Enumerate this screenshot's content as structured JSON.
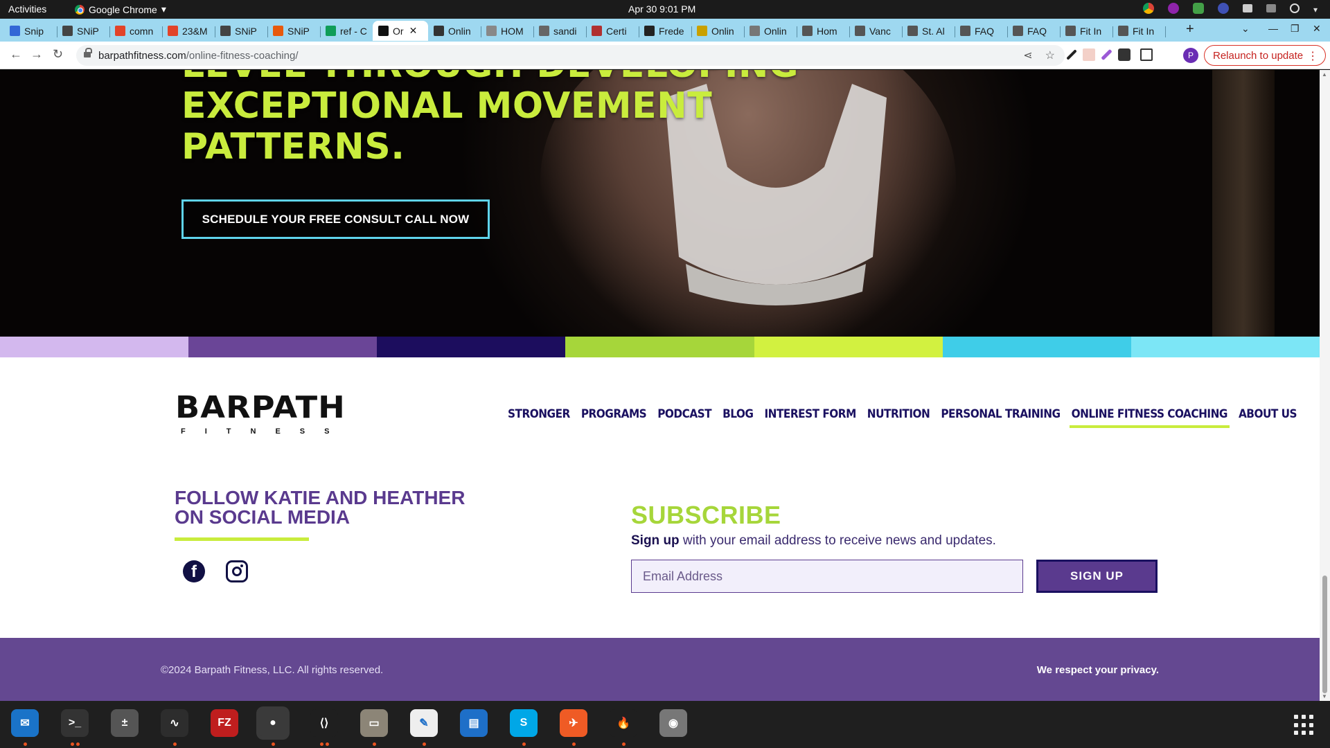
{
  "system": {
    "activities": "Activities",
    "app_name": "Google Chrome",
    "clock": "Apr 30  9:01 PM"
  },
  "browser": {
    "tabs": [
      {
        "label": "Snip",
        "icon": "doc-icon",
        "color": "#3367d6"
      },
      {
        "label": "SNiP",
        "icon": "snip-icon",
        "color": "#444444"
      },
      {
        "label": "comn",
        "icon": "gitlab-icon",
        "color": "#e24329"
      },
      {
        "label": "23&M",
        "icon": "gitlab-icon",
        "color": "#e24329"
      },
      {
        "label": "SNiP",
        "icon": "snip-icon",
        "color": "#444444"
      },
      {
        "label": "SNiP",
        "icon": "snip-orange-icon",
        "color": "#e8590c"
      },
      {
        "label": "ref - C",
        "icon": "sheets-icon",
        "color": "#0f9d58"
      },
      {
        "label": "Or",
        "icon": "barpath-icon",
        "color": "#111111",
        "active": true
      },
      {
        "label": "Onlin",
        "icon": "bird-icon",
        "color": "#333333"
      },
      {
        "label": "HOM",
        "icon": "circle-icon",
        "color": "#888888"
      },
      {
        "label": "sandi",
        "icon": "globe-icon",
        "color": "#666666"
      },
      {
        "label": "Certi",
        "icon": "ship-icon",
        "color": "#b03030"
      },
      {
        "label": "Frede",
        "icon": "note-icon",
        "color": "#222222"
      },
      {
        "label": "Onlin",
        "icon": "grid-icon",
        "color": "#c9a000"
      },
      {
        "label": "Onlin",
        "icon": "dash-icon",
        "color": "#777777"
      },
      {
        "label": "Hom",
        "icon": "fit-icon",
        "color": "#555555"
      },
      {
        "label": "Vanc",
        "icon": "fit-icon",
        "color": "#555555"
      },
      {
        "label": "St. Al",
        "icon": "fit-icon",
        "color": "#555555"
      },
      {
        "label": "FAQ",
        "icon": "fit-icon",
        "color": "#555555"
      },
      {
        "label": "FAQ",
        "icon": "fit-icon",
        "color": "#555555"
      },
      {
        "label": "Fit In",
        "icon": "fit-icon",
        "color": "#555555"
      },
      {
        "label": "Fit In",
        "icon": "fit-icon",
        "color": "#555555"
      }
    ],
    "new_tab": "+",
    "url_host": "barpathfitness.com",
    "url_path": "/online-fitness-coaching/",
    "profile_initial": "P",
    "relaunch_label": "Relaunch to update"
  },
  "page": {
    "hero_heading_lines": [
      "LEVEL THROUGH DEVELOPING",
      "EXCEPTIONAL MOVEMENT",
      "PATTERNS."
    ],
    "cta_label": "SCHEDULE YOUR FREE CONSULT CALL NOW",
    "stripe_colors": [
      "#d3b8ee",
      "#6a4597",
      "#1c0d5e",
      "#a6d63a",
      "#d2f140",
      "#3fcde8",
      "#7ce6f6"
    ],
    "logo_word": "BARPATH",
    "logo_sub": "FITNESS",
    "nav_items": [
      {
        "label": "STRONGER"
      },
      {
        "label": "PROGRAMS"
      },
      {
        "label": "PODCAST"
      },
      {
        "label": "BLOG"
      },
      {
        "label": "INTEREST FORM"
      },
      {
        "label": "NUTRITION"
      },
      {
        "label": "PERSONAL TRAINING"
      },
      {
        "label": "ONLINE FITNESS COACHING",
        "current": true
      },
      {
        "label": "ABOUT US"
      }
    ],
    "follow_title": "FOLLOW KATIE AND HEATHER ON SOCIAL MEDIA",
    "social": {
      "facebook_glyph": "f"
    },
    "subscribe_title": "SUBSCRIBE",
    "subscribe_bold": "Sign up",
    "subscribe_text": " with your email address to receive news and updates.",
    "email_placeholder": "Email Address",
    "signup_label": "SIGN UP",
    "copyright": "©2024 Barpath Fitness, LLC. All rights reserved.",
    "privacy": "We respect your privacy."
  },
  "colors": {
    "accent_lime": "#c9ec3d",
    "accent_purple": "#5a3a8e",
    "navy": "#1a1060"
  },
  "dock": [
    {
      "name": "thunderbird-icon",
      "bg": "#1a73c8",
      "glyph": "✉",
      "running": true
    },
    {
      "name": "terminal-icon",
      "bg": "#333333",
      "glyph": ">_",
      "running": true,
      "dots": 2
    },
    {
      "name": "calculator-icon",
      "bg": "#555555",
      "glyph": "±",
      "running": false
    },
    {
      "name": "system-monitor-icon",
      "bg": "#2d2d2d",
      "glyph": "∿",
      "running": true
    },
    {
      "name": "filezilla-icon",
      "bg": "#bf1e1e",
      "glyph": "FZ",
      "running": false
    },
    {
      "name": "chrome-icon",
      "bg": "#3a3a3a",
      "glyph": "●",
      "running": true,
      "active": true
    },
    {
      "name": "vscode-icon",
      "bg": "#1f1f1f",
      "glyph": "⟨⟩",
      "running": true,
      "dots": 2
    },
    {
      "name": "files-icon",
      "bg": "#8c8577",
      "glyph": "▭",
      "running": true
    },
    {
      "name": "text-editor-icon",
      "bg": "#eeeeee",
      "glyph": "✎",
      "running": true
    },
    {
      "name": "writer-icon",
      "bg": "#1e6fc8",
      "glyph": "▤",
      "running": false
    },
    {
      "name": "skype-icon",
      "bg": "#00a7e7",
      "glyph": "S",
      "running": true
    },
    {
      "name": "postman-icon",
      "bg": "#ef5b25",
      "glyph": "✈",
      "running": true
    },
    {
      "name": "burp-icon",
      "bg": "#1f1f1f",
      "glyph": "🔥",
      "running": true
    },
    {
      "name": "disc-icon",
      "bg": "#777777",
      "glyph": "◉",
      "running": false
    }
  ]
}
